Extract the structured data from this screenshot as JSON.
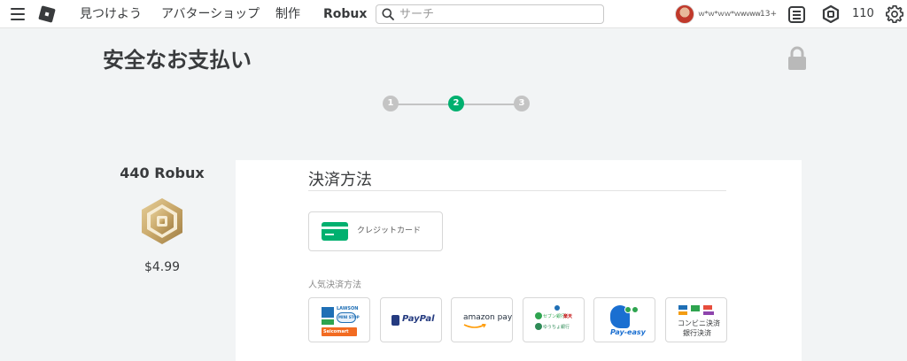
{
  "nav": {
    "discover": "見つけよう",
    "avatar_shop": "アバターショップ",
    "create": "制作",
    "robux": "Robux"
  },
  "search": {
    "placeholder": "サーチ",
    "value": ""
  },
  "user": {
    "name": "ｗ*ｗ*ｗｗ*ｗwvww",
    "age_badge": "13+",
    "robux_balance": "110"
  },
  "page": {
    "title": "安全なお支払い"
  },
  "stepper": {
    "steps": [
      "1",
      "2",
      "3"
    ],
    "current": 2
  },
  "product": {
    "name": "440 Robux",
    "price": "$4.99"
  },
  "payment": {
    "title": "決済方法",
    "credit_card_label": "クレジットカード",
    "popular_label": "人気決済方法",
    "methods": {
      "convenience": {
        "lawson": "LAWSON",
        "ministop": "MINI STOP",
        "seicomart": "Seicomart"
      },
      "paypal": {
        "label": "PayPal"
      },
      "amazon": {
        "label": "amazon pay"
      },
      "banks": {
        "label_1": "セブン銀行",
        "label_2": "楽天",
        "label_3": "ゆうちょ銀行"
      },
      "payeasy": {
        "label": "Pay-easy"
      },
      "konbini_bank": {
        "line_1": "コンビニ決済",
        "line_2": "銀行決済"
      }
    }
  },
  "colors": {
    "accent_green": "#00b06f",
    "step_inactive": "#c4c4c4",
    "robux_gold": "#c9a86a",
    "paypal_dark": "#253b80",
    "paypal_light": "#179bd7",
    "payeasy_blue": "#1a6fd1"
  }
}
